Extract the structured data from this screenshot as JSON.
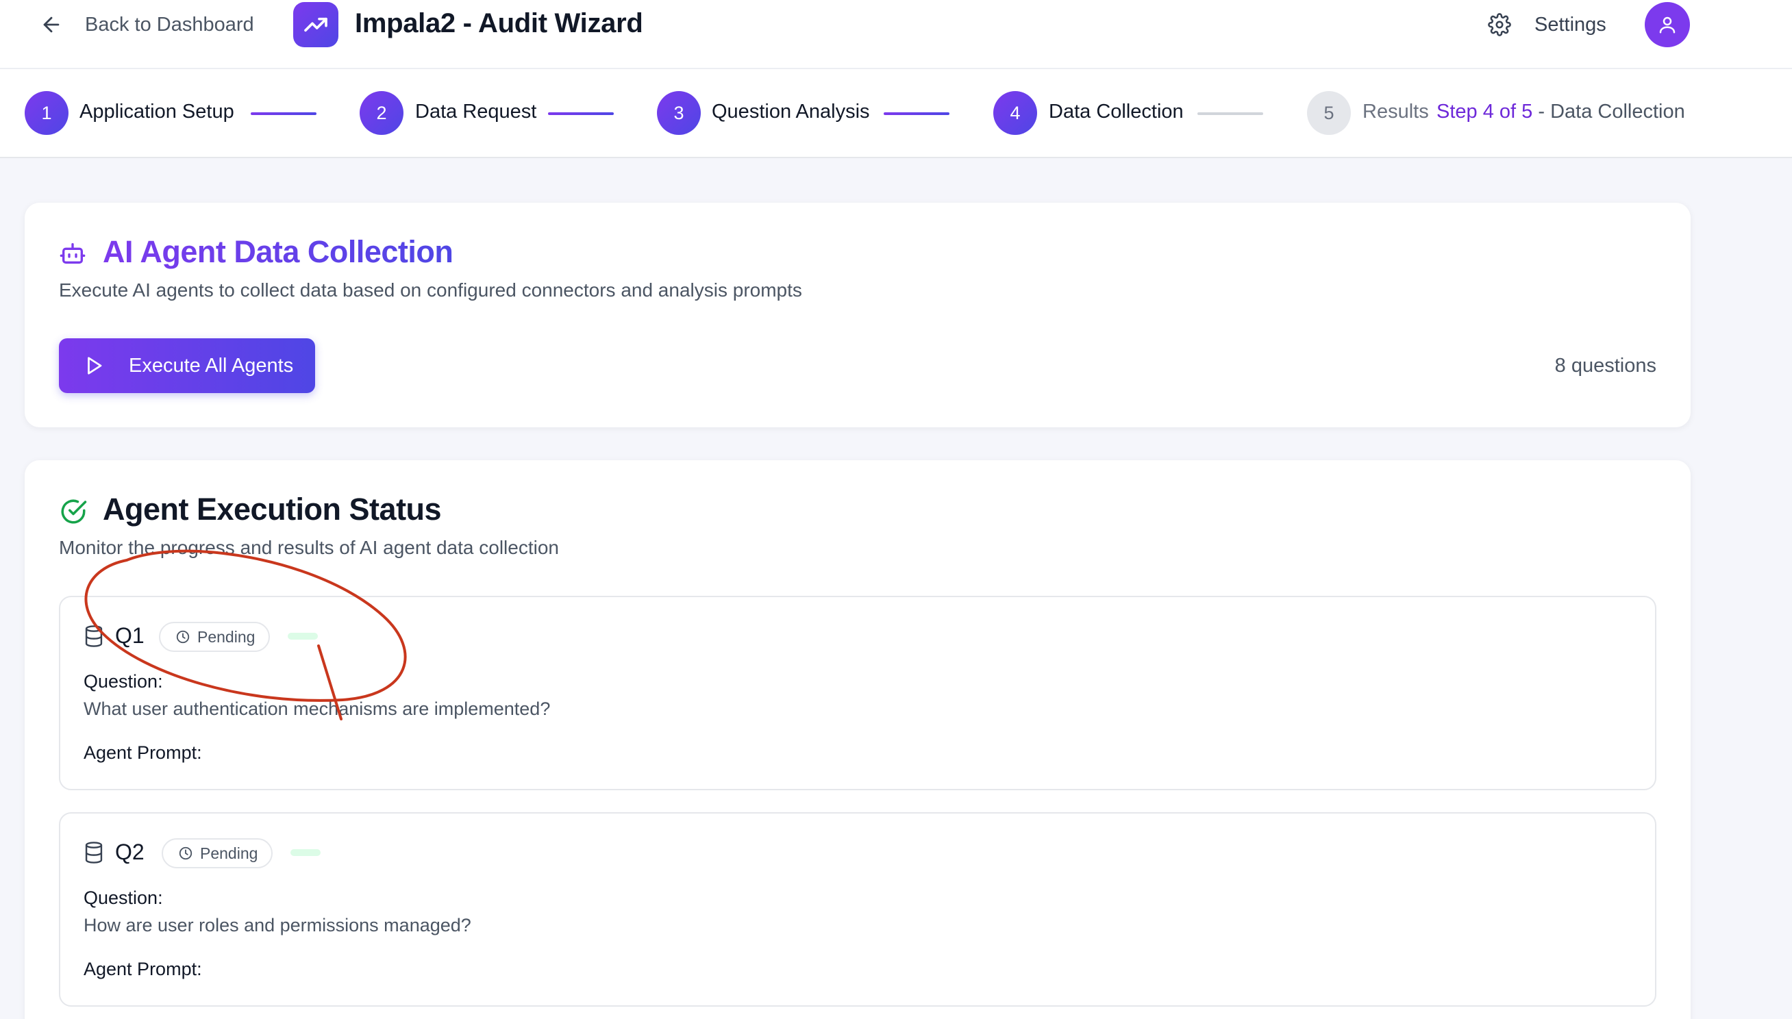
{
  "header": {
    "back_label": "Back to Dashboard",
    "app_title": "Impala2 - Audit Wizard",
    "settings_label": "Settings"
  },
  "stepper": {
    "steps": [
      {
        "number": "1",
        "label": "Application Setup",
        "state": "completed"
      },
      {
        "number": "2",
        "label": "Data Request",
        "state": "completed"
      },
      {
        "number": "3",
        "label": "Question Analysis",
        "state": "completed"
      },
      {
        "number": "4",
        "label": "Data Collection",
        "state": "current"
      },
      {
        "number": "5",
        "label": "Results",
        "state": "upcoming"
      }
    ],
    "progress": {
      "step_word": "Step 4 of 5",
      "separator": " - ",
      "current_name": "Data Collection"
    }
  },
  "collection": {
    "title": "AI Agent Data Collection",
    "description": "Execute AI agents to collect data based on configured connectors and analysis prompts",
    "execute_button": "Execute All Agents",
    "question_count": "8 questions"
  },
  "status": {
    "title": "Agent Execution Status",
    "description": "Monitor the progress and results of AI agent data collection",
    "items": [
      {
        "id": "Q1",
        "badge": "Pending",
        "progress": 0,
        "question_label": "Question:",
        "question": "What user authentication mechanisms are implemented?",
        "prompt_label": "Agent Prompt:"
      },
      {
        "id": "Q2",
        "badge": "Pending",
        "progress": 0,
        "question_label": "Question:",
        "question": "How are user roles and permissions managed?",
        "prompt_label": "Agent Prompt:"
      }
    ]
  },
  "colors": {
    "accent_purple": "#7c3aed",
    "accent_indigo": "#4f46e5",
    "success_green": "#22c55e",
    "annotation_red": "#c9371d"
  },
  "icons": {
    "back": "arrow-left-icon",
    "logo": "trending-up-icon",
    "settings": "gear-icon",
    "avatar": "user-icon",
    "collection": "robot-icon",
    "execute": "play-icon",
    "status": "check-circle-icon",
    "question": "database-icon",
    "badge": "clock-icon"
  }
}
